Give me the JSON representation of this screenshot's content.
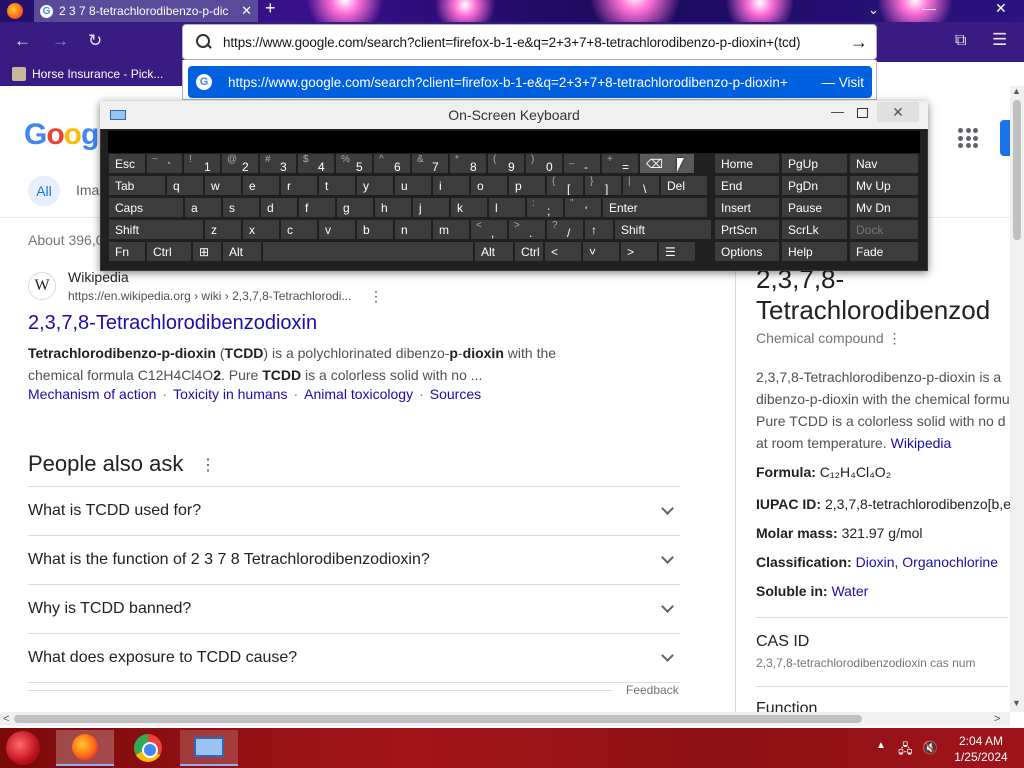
{
  "browser": {
    "tab_title": "2 3 7 8-tetrachlorodibenzo-p-dic",
    "bookmark_label": "Horse Insurance - Pick...",
    "url": "https://www.google.com/search?client=firefox-b-1-e&q=2+3+7+8-tetrachlorodibenzo-p-dioxin+(tcd)",
    "suggestion": "https://www.google.com/search?client=firefox-b-1-e&q=2+3+7+8-tetrachlorodibenzo-p-dioxin+",
    "suggestion_action": "— Visit"
  },
  "google": {
    "logo": "Googl",
    "tabs": [
      "All",
      "Ima"
    ],
    "result_stats": "About 396,0",
    "result": {
      "site": "Wikipedia",
      "cite": "https://en.wikipedia.org › wiki › 2,3,7,8-Tetrachlorodi...",
      "title": "2,3,7,8-Tetrachlorodibenzodioxin",
      "snippet_1a": "Tetrachlorodibenzo-p-dioxin",
      "snippet_1b": " (",
      "snippet_1c": "TCDD",
      "snippet_1d": ") is a polychlorinated dibenzo-",
      "snippet_1e": "p",
      "snippet_1f": "-",
      "snippet_1g": "dioxin",
      "snippet_1h": " with the",
      "snippet_2a": "chemical formula C12H4Cl4O",
      "snippet_2b": "2",
      "snippet_2c": ". Pure ",
      "snippet_2d": "TCDD",
      "snippet_2e": " is a colorless solid with no ...",
      "sitelinks": [
        "Mechanism of action",
        "Toxicity in humans",
        "Animal toxicology",
        "Sources"
      ]
    },
    "paa": {
      "title": "People also ask",
      "questions": [
        "What is TCDD used for?",
        "What is the function of 2 3 7 8 Tetrachlorodibenzodioxin?",
        "Why is TCDD banned?",
        "What does exposure to TCDD cause?"
      ],
      "feedback": "Feedback"
    },
    "knowledge_panel": {
      "title_1": "2,3,7,8-",
      "title_2": "Tetrachlorodibenzod",
      "subtitle": "Chemical compound",
      "desc_1": "2,3,7,8-Tetrachlorodibenzo-p-dioxin is a",
      "desc_2": "dibenzo-p-dioxin with the chemical formu",
      "desc_3": "Pure TCDD is a colorless solid with no d",
      "desc_4a": "at room temperature. ",
      "desc_4b": "Wikipedia",
      "formula_label": "Formula:",
      "formula_value": "C₁₂H₄Cl₄O₂",
      "iupac_label": "IUPAC ID:",
      "iupac_value": "2,3,7,8-tetrachlorodibenzo[b,e",
      "molar_label": "Molar mass:",
      "molar_value": "321.97 g/mol",
      "class_label": "Classification:",
      "class_value_1": "Dioxin",
      "class_sep": ", ",
      "class_value_2": "Organochlorine",
      "soluble_label": "Soluble in:",
      "soluble_value": "Water",
      "cas_label": "CAS ID",
      "cas_sub": "2,3,7,8-tetrachlorodibenzodioxin cas num",
      "function_label": "Function"
    }
  },
  "osk": {
    "title": "On-Screen Keyboard",
    "row1": [
      {
        "label": "Esc"
      },
      {
        "shift": "~",
        "main": "`"
      },
      {
        "shift": "!",
        "main": "1"
      },
      {
        "shift": "@",
        "main": "2"
      },
      {
        "shift": "#",
        "main": "3"
      },
      {
        "shift": "$",
        "main": "4"
      },
      {
        "shift": "%",
        "main": "5"
      },
      {
        "shift": "^",
        "main": "6"
      },
      {
        "shift": "&",
        "main": "7"
      },
      {
        "shift": "*",
        "main": "8"
      },
      {
        "shift": "(",
        "main": "9"
      },
      {
        "shift": ")",
        "main": "0"
      },
      {
        "shift": "_",
        "main": "-"
      },
      {
        "shift": "+",
        "main": "="
      },
      {
        "label": "⌫"
      }
    ],
    "row2": [
      "Tab",
      "q",
      "w",
      "e",
      "r",
      "t",
      "y",
      "u",
      "i",
      "o",
      "p",
      "[",
      "]",
      "\\",
      "Del"
    ],
    "row2_shift": [
      "",
      "",
      "",
      "",
      "",
      "",
      "",
      "",
      "",
      "",
      "",
      "{",
      "}",
      "|",
      ""
    ],
    "row3": [
      "Caps",
      "a",
      "s",
      "d",
      "f",
      "g",
      "h",
      "j",
      "k",
      "l",
      ";",
      "'",
      "Enter"
    ],
    "row3_shift": [
      "",
      "",
      "",
      "",
      "",
      "",
      "",
      "",
      "",
      "",
      ":",
      "\"",
      ""
    ],
    "row4": [
      "Shift",
      "z",
      "x",
      "c",
      "v",
      "b",
      "n",
      "m",
      ",",
      ".",
      "/",
      "↑",
      "Shift"
    ],
    "row4_shift": [
      "",
      "",
      "",
      "",
      "",
      "",
      "",
      "",
      "<",
      ">",
      "?",
      "",
      ""
    ],
    "row5": [
      "Fn",
      "Ctrl",
      "⊞",
      "Alt",
      "",
      "Alt",
      "Ctrl",
      "<",
      "˅",
      ">",
      "☰"
    ],
    "nav_keys": [
      [
        "Home",
        "PgUp",
        "Nav"
      ],
      [
        "End",
        "PgDn",
        "Mv Up"
      ],
      [
        "Insert",
        "Pause",
        "Mv Dn"
      ],
      [
        "PrtScn",
        "ScrLk",
        "Dock"
      ],
      [
        "Options",
        "Help",
        "Fade"
      ]
    ]
  },
  "taskbar": {
    "time": "2:04 AM",
    "date": "1/25/2024"
  },
  "colors": {
    "accent": "#0061e0",
    "link": "#1a0dab",
    "taskbar": "#a5151a"
  }
}
